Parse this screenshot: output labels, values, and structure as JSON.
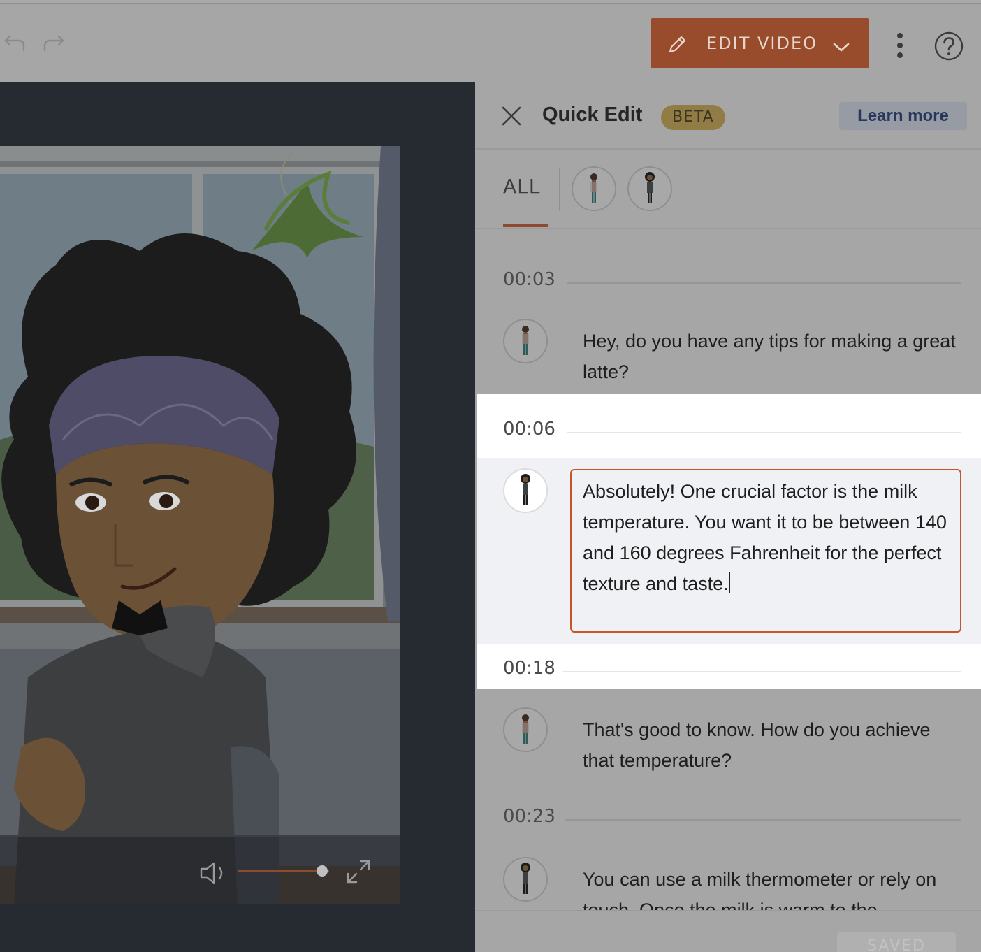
{
  "toolbar": {
    "undo_icon": "undo-icon",
    "redo_icon": "redo-icon",
    "edit_video_label": "EDIT VIDEO",
    "more_icon": "more-vertical-icon",
    "help_icon": "help-icon"
  },
  "player": {
    "volume_level": 0.92
  },
  "quick_edit": {
    "title": "Quick Edit",
    "badge": "BETA",
    "learn_more": "Learn more",
    "filter_all": "ALL",
    "lines": [
      {
        "time": "00:03",
        "speaker": "character-1",
        "text": "Hey, do you have any tips for making a great latte?"
      },
      {
        "time": "00:06",
        "speaker": "character-2",
        "text": "Absolutely! One crucial factor is the milk temperature. You want it to be between 140 and 160 degrees Fahrenheit for the perfect texture and taste."
      },
      {
        "time": "00:18",
        "speaker": "character-1",
        "text": "That's good to know. How do you achieve that temperature?"
      },
      {
        "time": "00:23",
        "speaker": "character-2",
        "text": "You can use a milk thermometer or rely on touch. Once the milk is warm to the"
      }
    ],
    "save_label": "SAVED"
  }
}
